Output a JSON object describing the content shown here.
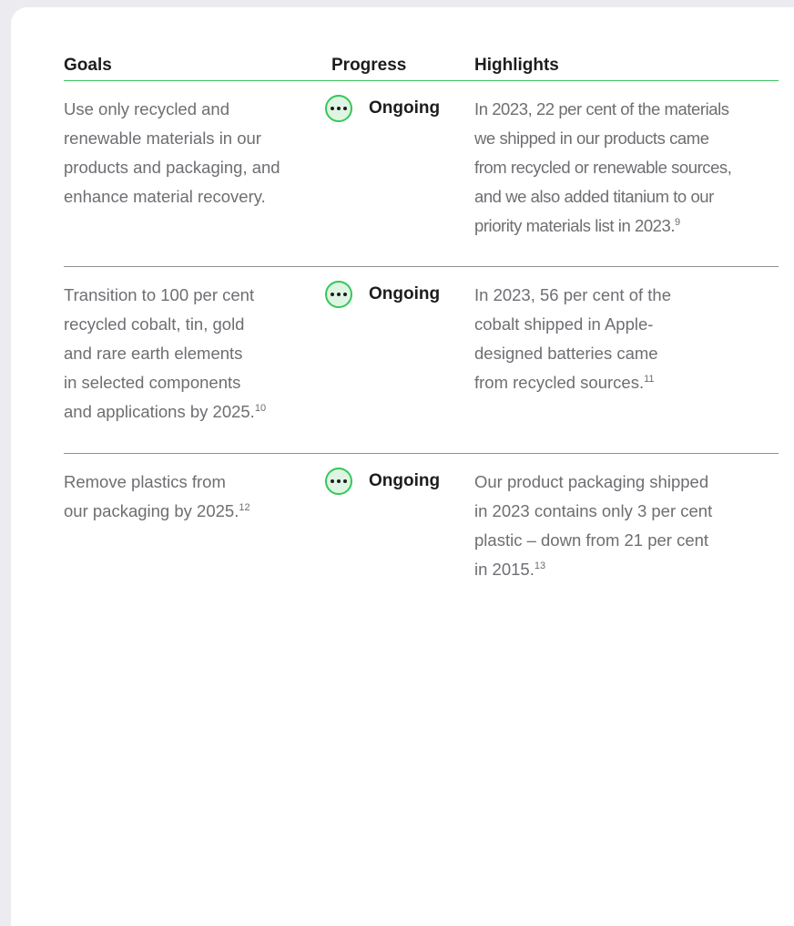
{
  "columns": {
    "goals": "Goals",
    "progress": "Progress",
    "highlights": "Highlights"
  },
  "status_icon": "ellipsis-circle-icon",
  "accent_color": "#34c759",
  "rows": [
    {
      "goal_lines": [
        "Use only recycled and",
        "renewable materials in our",
        "products and packaging, and",
        "enhance material recovery."
      ],
      "progress": "Ongoing",
      "highlight_lines": [
        "In 2023, 22 per cent of the materials",
        "we shipped in our products came",
        "from recycled or renewable sources,",
        "and we also added titanium to our",
        "priority materials list in 2023."
      ],
      "highlight_note": "9"
    },
    {
      "goal_lines": [
        "Transition to 100 per cent",
        "recycled cobalt, tin, gold",
        "and rare earth elements",
        "in selected components",
        "and applications by 2025."
      ],
      "goal_note": "10",
      "progress": "Ongoing",
      "highlight_lines": [
        "In 2023, 56 per cent of the",
        "cobalt shipped in Apple-",
        "designed batteries came",
        "from recycled sources."
      ],
      "highlight_note": "11"
    },
    {
      "goal_lines": [
        "Remove plastics from",
        "our packaging by 2025."
      ],
      "goal_note": "12",
      "progress": "Ongoing",
      "highlight_lines": [
        "Our product packaging shipped",
        "in 2023 contains only 3 per cent",
        "plastic – down from 21 per cent",
        "in 2015."
      ],
      "highlight_note": "13"
    }
  ]
}
